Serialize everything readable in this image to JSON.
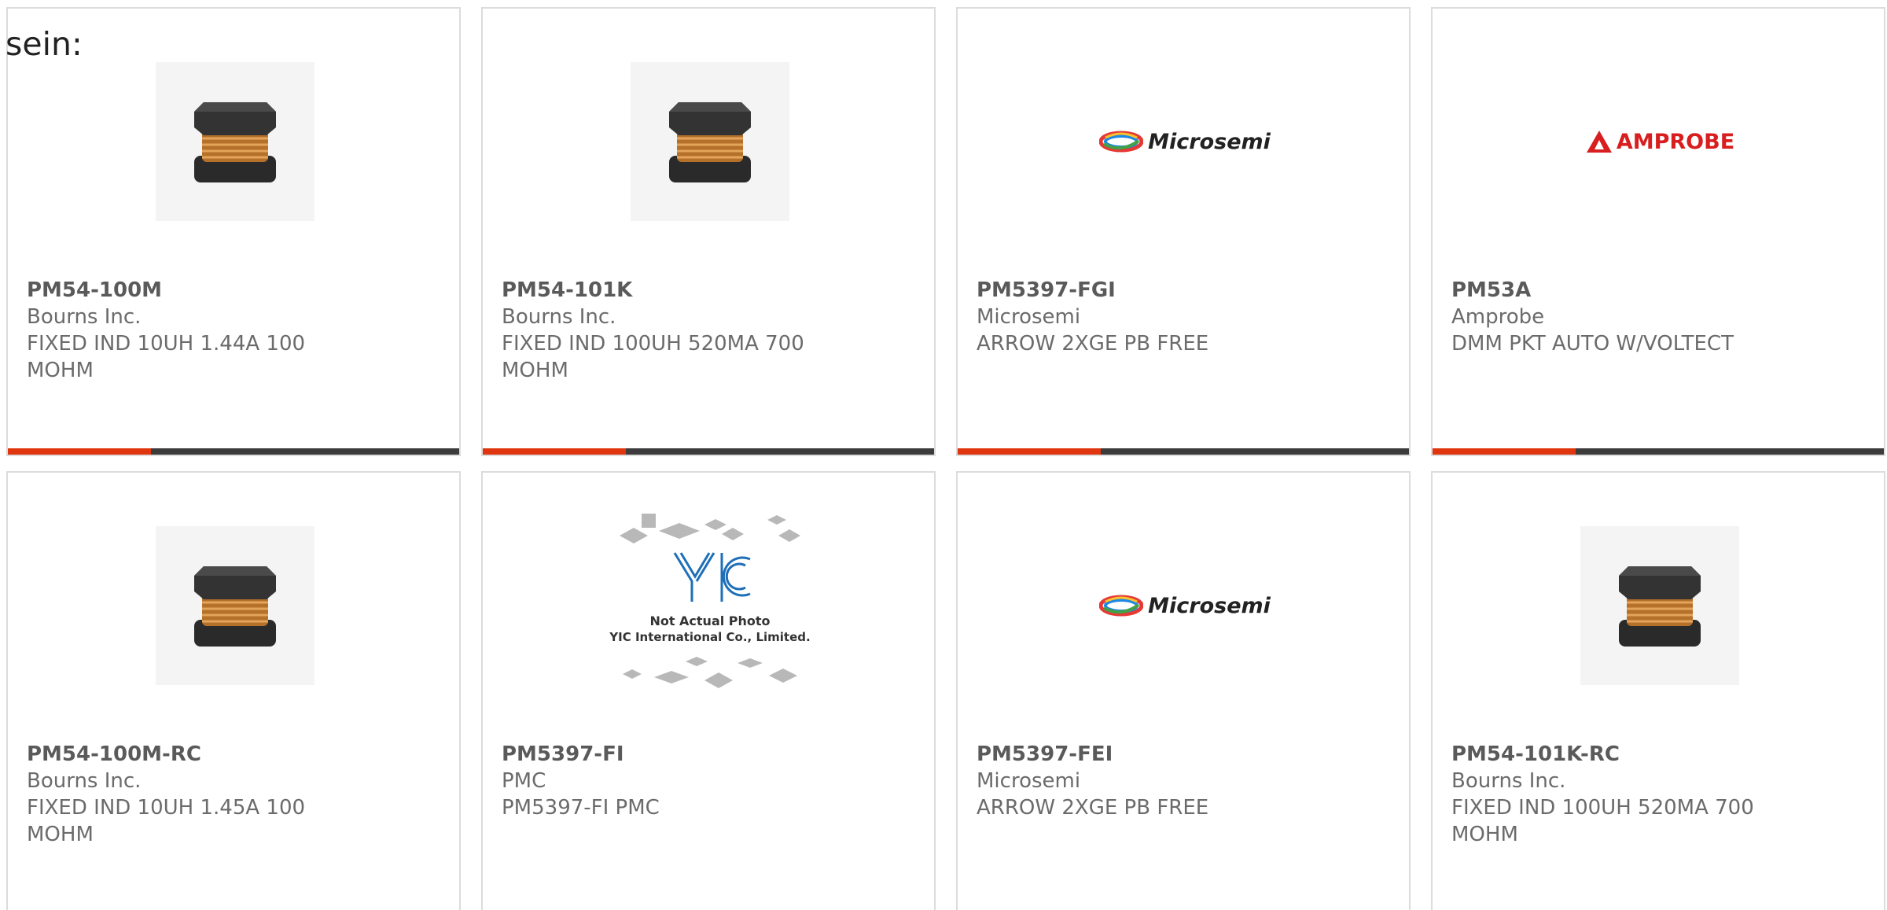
{
  "intro_text": "sein:",
  "colors": {
    "accent": "#e0360f",
    "bar": "#3c3c3c",
    "border": "#dcdcdc",
    "text": "#6b6b6b"
  },
  "products": [
    {
      "part": "PM54-100M",
      "manufacturer": "Bourns Inc.",
      "description": "FIXED IND 10UH 1.44A 100 MOHM",
      "image": "inductor"
    },
    {
      "part": "PM54-101K",
      "manufacturer": "Bourns Inc.",
      "description": "FIXED IND 100UH 520MA 700 MOHM",
      "image": "inductor"
    },
    {
      "part": "PM5397-FGI",
      "manufacturer": "Microsemi",
      "description": "ARROW 2XGE PB FREE",
      "image": "microsemi-logo",
      "logo_text": "Microsemi"
    },
    {
      "part": "PM53A",
      "manufacturer": "Amprobe",
      "description": "DMM PKT AUTO W/VOLTECT",
      "image": "amprobe-logo",
      "logo_text": "AMPROBE"
    },
    {
      "part": "PM54-100M-RC",
      "manufacturer": "Bourns Inc.",
      "description": "FIXED IND 10UH 1.45A 100 MOHM",
      "image": "inductor"
    },
    {
      "part": "PM5397-FI",
      "manufacturer": "PMC",
      "description": "PM5397-FI PMC",
      "image": "yic-placeholder",
      "photo_note_1": "Not Actual Photo",
      "photo_note_2": "YIC International Co., Limited."
    },
    {
      "part": "PM5397-FEI",
      "manufacturer": "Microsemi",
      "description": "ARROW 2XGE PB FREE",
      "image": "microsemi-logo",
      "logo_text": "Microsemi"
    },
    {
      "part": "PM54-101K-RC",
      "manufacturer": "Bourns Inc.",
      "description": "FIXED IND 100UH 520MA 700 MOHM",
      "image": "inductor"
    }
  ]
}
